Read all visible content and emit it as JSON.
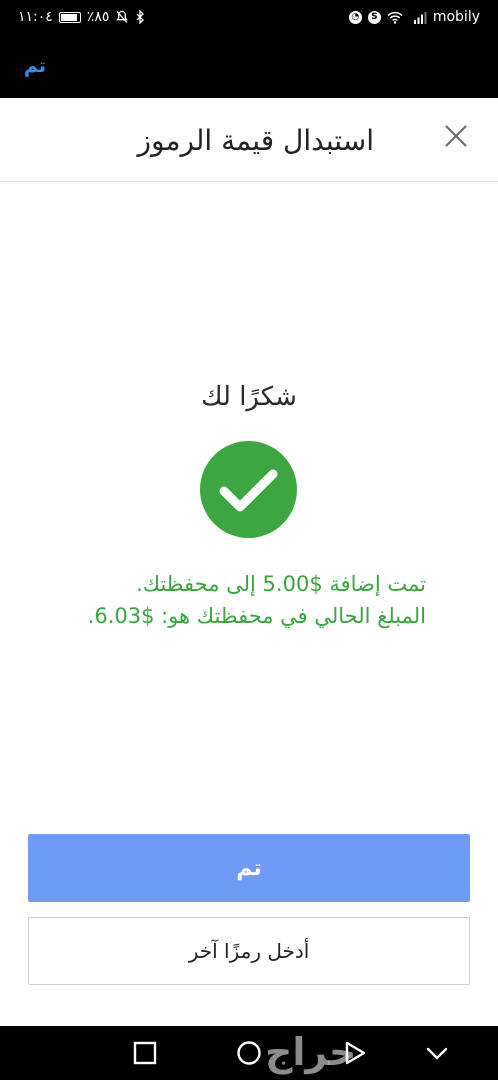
{
  "status_bar": {
    "time": "١١:٠٤",
    "battery": "٪٨٥",
    "carrier": "mobily"
  },
  "top_bar": {
    "done_label": "تم"
  },
  "dialog": {
    "title": "استبدال قيمة الرموز",
    "close_icon": "close-icon",
    "thanks": "شكرًا لك",
    "success_icon": "check-circle-icon",
    "message_line1": "تمت إضافة $5.00 إلى محفظتك.",
    "message_line2": "المبلغ الحالي في محفظتك هو: $6.03.",
    "done_button": "تم",
    "enter_another_button": "أدخل رمزًا آخر"
  },
  "watermark": "حراج",
  "colors": {
    "accent_link": "#2f8ff0",
    "success_green": "#3aa53e",
    "check_circle": "#3ca740",
    "primary_button": "#6f9bf7"
  }
}
